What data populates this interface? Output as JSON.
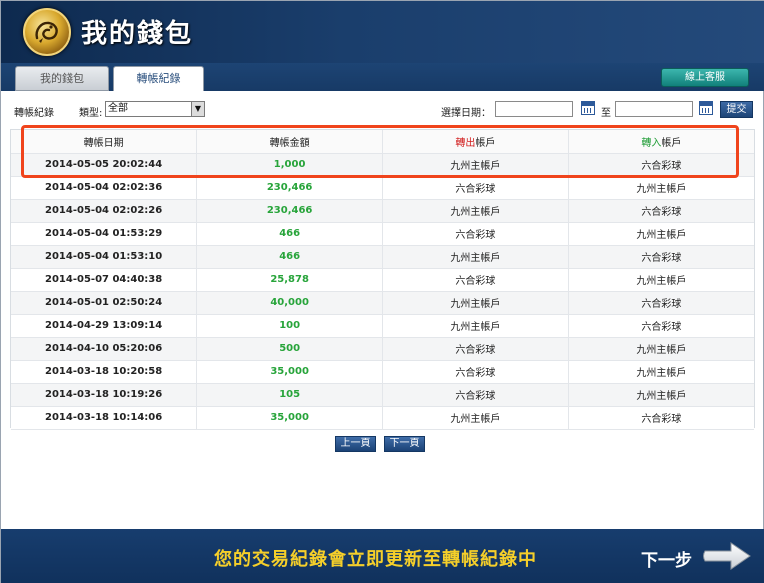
{
  "header": {
    "title": "我的錢包",
    "logo_icon": "dragon-emblem-icon"
  },
  "tabs": [
    {
      "label": "我的錢包",
      "active": false
    },
    {
      "label": "轉帳紀錄",
      "active": true
    }
  ],
  "support_button": "線上客服",
  "filters": {
    "record_label": "轉帳紀錄",
    "type_label": "類型:",
    "type_value": "全部",
    "date_label": "選擇日期：",
    "to_label": "至",
    "submit_label": "提交",
    "date_from": "",
    "date_to": ""
  },
  "table": {
    "headers": {
      "date": "轉帳日期",
      "amount": "轉帳金額",
      "out_prefix": "轉出",
      "out_suffix": "帳戶",
      "in_prefix": "轉入",
      "in_suffix": "帳戶"
    },
    "rows": [
      {
        "date": "2014-05-05 20:02:44",
        "amount": "1,000",
        "from": "九州主帳戶",
        "to": "六合彩球"
      },
      {
        "date": "2014-05-04 02:02:36",
        "amount": "230,466",
        "from": "六合彩球",
        "to": "九州主帳戶"
      },
      {
        "date": "2014-05-04 02:02:26",
        "amount": "230,466",
        "from": "九州主帳戶",
        "to": "六合彩球"
      },
      {
        "date": "2014-05-04 01:53:29",
        "amount": "466",
        "from": "六合彩球",
        "to": "九州主帳戶"
      },
      {
        "date": "2014-05-04 01:53:10",
        "amount": "466",
        "from": "九州主帳戶",
        "to": "六合彩球"
      },
      {
        "date": "2014-05-07 04:40:38",
        "amount": "25,878",
        "from": "六合彩球",
        "to": "九州主帳戶"
      },
      {
        "date": "2014-05-01 02:50:24",
        "amount": "40,000",
        "from": "九州主帳戶",
        "to": "六合彩球"
      },
      {
        "date": "2014-04-29 13:09:14",
        "amount": "100",
        "from": "九州主帳戶",
        "to": "六合彩球"
      },
      {
        "date": "2014-04-10 05:20:06",
        "amount": "500",
        "from": "六合彩球",
        "to": "九州主帳戶"
      },
      {
        "date": "2014-03-18 10:20:58",
        "amount": "35,000",
        "from": "六合彩球",
        "to": "九州主帳戶"
      },
      {
        "date": "2014-03-18 10:19:26",
        "amount": "105",
        "from": "六合彩球",
        "to": "九州主帳戶"
      },
      {
        "date": "2014-03-18 10:14:06",
        "amount": "35,000",
        "from": "九州主帳戶",
        "to": "六合彩球"
      }
    ]
  },
  "pagination": {
    "prev_label": "上一頁",
    "next_label": "下一頁"
  },
  "footer": {
    "message": "您的交易紀錄會立即更新至轉帳紀錄中",
    "next_step": "下一步",
    "arrow_icon": "right-arrow-icon"
  },
  "colors": {
    "header_bg": "#173a66",
    "amount_green": "#27a43a",
    "out_red": "#d11c1c",
    "in_green": "#1e9c35",
    "highlight": "#f0441c",
    "footer_text": "#f5cf2a"
  }
}
